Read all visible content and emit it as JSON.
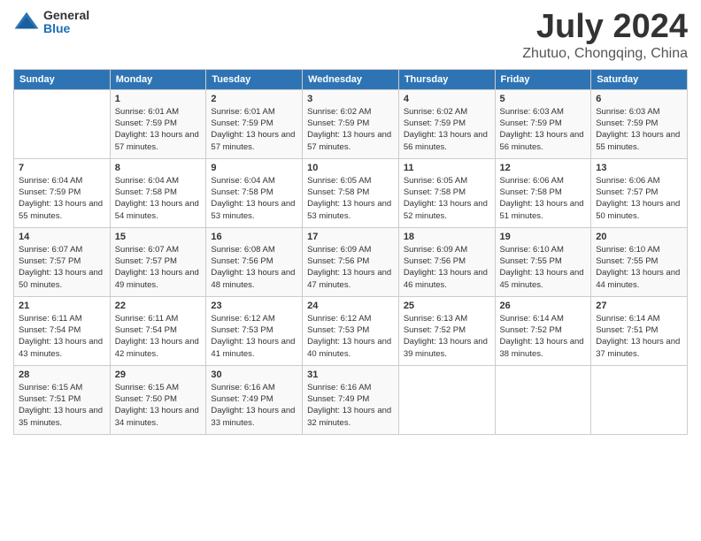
{
  "header": {
    "logo_general": "General",
    "logo_blue": "Blue",
    "title": "July 2024",
    "subtitle": "Zhutuo, Chongqing, China"
  },
  "days_of_week": [
    "Sunday",
    "Monday",
    "Tuesday",
    "Wednesday",
    "Thursday",
    "Friday",
    "Saturday"
  ],
  "weeks": [
    [
      {
        "day": "",
        "sunrise": "",
        "sunset": "",
        "daylight": ""
      },
      {
        "day": "1",
        "sunrise": "Sunrise: 6:01 AM",
        "sunset": "Sunset: 7:59 PM",
        "daylight": "Daylight: 13 hours and 57 minutes."
      },
      {
        "day": "2",
        "sunrise": "Sunrise: 6:01 AM",
        "sunset": "Sunset: 7:59 PM",
        "daylight": "Daylight: 13 hours and 57 minutes."
      },
      {
        "day": "3",
        "sunrise": "Sunrise: 6:02 AM",
        "sunset": "Sunset: 7:59 PM",
        "daylight": "Daylight: 13 hours and 57 minutes."
      },
      {
        "day": "4",
        "sunrise": "Sunrise: 6:02 AM",
        "sunset": "Sunset: 7:59 PM",
        "daylight": "Daylight: 13 hours and 56 minutes."
      },
      {
        "day": "5",
        "sunrise": "Sunrise: 6:03 AM",
        "sunset": "Sunset: 7:59 PM",
        "daylight": "Daylight: 13 hours and 56 minutes."
      },
      {
        "day": "6",
        "sunrise": "Sunrise: 6:03 AM",
        "sunset": "Sunset: 7:59 PM",
        "daylight": "Daylight: 13 hours and 55 minutes."
      }
    ],
    [
      {
        "day": "7",
        "sunrise": "Sunrise: 6:04 AM",
        "sunset": "Sunset: 7:59 PM",
        "daylight": "Daylight: 13 hours and 55 minutes."
      },
      {
        "day": "8",
        "sunrise": "Sunrise: 6:04 AM",
        "sunset": "Sunset: 7:58 PM",
        "daylight": "Daylight: 13 hours and 54 minutes."
      },
      {
        "day": "9",
        "sunrise": "Sunrise: 6:04 AM",
        "sunset": "Sunset: 7:58 PM",
        "daylight": "Daylight: 13 hours and 53 minutes."
      },
      {
        "day": "10",
        "sunrise": "Sunrise: 6:05 AM",
        "sunset": "Sunset: 7:58 PM",
        "daylight": "Daylight: 13 hours and 53 minutes."
      },
      {
        "day": "11",
        "sunrise": "Sunrise: 6:05 AM",
        "sunset": "Sunset: 7:58 PM",
        "daylight": "Daylight: 13 hours and 52 minutes."
      },
      {
        "day": "12",
        "sunrise": "Sunrise: 6:06 AM",
        "sunset": "Sunset: 7:58 PM",
        "daylight": "Daylight: 13 hours and 51 minutes."
      },
      {
        "day": "13",
        "sunrise": "Sunrise: 6:06 AM",
        "sunset": "Sunset: 7:57 PM",
        "daylight": "Daylight: 13 hours and 50 minutes."
      }
    ],
    [
      {
        "day": "14",
        "sunrise": "Sunrise: 6:07 AM",
        "sunset": "Sunset: 7:57 PM",
        "daylight": "Daylight: 13 hours and 50 minutes."
      },
      {
        "day": "15",
        "sunrise": "Sunrise: 6:07 AM",
        "sunset": "Sunset: 7:57 PM",
        "daylight": "Daylight: 13 hours and 49 minutes."
      },
      {
        "day": "16",
        "sunrise": "Sunrise: 6:08 AM",
        "sunset": "Sunset: 7:56 PM",
        "daylight": "Daylight: 13 hours and 48 minutes."
      },
      {
        "day": "17",
        "sunrise": "Sunrise: 6:09 AM",
        "sunset": "Sunset: 7:56 PM",
        "daylight": "Daylight: 13 hours and 47 minutes."
      },
      {
        "day": "18",
        "sunrise": "Sunrise: 6:09 AM",
        "sunset": "Sunset: 7:56 PM",
        "daylight": "Daylight: 13 hours and 46 minutes."
      },
      {
        "day": "19",
        "sunrise": "Sunrise: 6:10 AM",
        "sunset": "Sunset: 7:55 PM",
        "daylight": "Daylight: 13 hours and 45 minutes."
      },
      {
        "day": "20",
        "sunrise": "Sunrise: 6:10 AM",
        "sunset": "Sunset: 7:55 PM",
        "daylight": "Daylight: 13 hours and 44 minutes."
      }
    ],
    [
      {
        "day": "21",
        "sunrise": "Sunrise: 6:11 AM",
        "sunset": "Sunset: 7:54 PM",
        "daylight": "Daylight: 13 hours and 43 minutes."
      },
      {
        "day": "22",
        "sunrise": "Sunrise: 6:11 AM",
        "sunset": "Sunset: 7:54 PM",
        "daylight": "Daylight: 13 hours and 42 minutes."
      },
      {
        "day": "23",
        "sunrise": "Sunrise: 6:12 AM",
        "sunset": "Sunset: 7:53 PM",
        "daylight": "Daylight: 13 hours and 41 minutes."
      },
      {
        "day": "24",
        "sunrise": "Sunrise: 6:12 AM",
        "sunset": "Sunset: 7:53 PM",
        "daylight": "Daylight: 13 hours and 40 minutes."
      },
      {
        "day": "25",
        "sunrise": "Sunrise: 6:13 AM",
        "sunset": "Sunset: 7:52 PM",
        "daylight": "Daylight: 13 hours and 39 minutes."
      },
      {
        "day": "26",
        "sunrise": "Sunrise: 6:14 AM",
        "sunset": "Sunset: 7:52 PM",
        "daylight": "Daylight: 13 hours and 38 minutes."
      },
      {
        "day": "27",
        "sunrise": "Sunrise: 6:14 AM",
        "sunset": "Sunset: 7:51 PM",
        "daylight": "Daylight: 13 hours and 37 minutes."
      }
    ],
    [
      {
        "day": "28",
        "sunrise": "Sunrise: 6:15 AM",
        "sunset": "Sunset: 7:51 PM",
        "daylight": "Daylight: 13 hours and 35 minutes."
      },
      {
        "day": "29",
        "sunrise": "Sunrise: 6:15 AM",
        "sunset": "Sunset: 7:50 PM",
        "daylight": "Daylight: 13 hours and 34 minutes."
      },
      {
        "day": "30",
        "sunrise": "Sunrise: 6:16 AM",
        "sunset": "Sunset: 7:49 PM",
        "daylight": "Daylight: 13 hours and 33 minutes."
      },
      {
        "day": "31",
        "sunrise": "Sunrise: 6:16 AM",
        "sunset": "Sunset: 7:49 PM",
        "daylight": "Daylight: 13 hours and 32 minutes."
      },
      {
        "day": "",
        "sunrise": "",
        "sunset": "",
        "daylight": ""
      },
      {
        "day": "",
        "sunrise": "",
        "sunset": "",
        "daylight": ""
      },
      {
        "day": "",
        "sunrise": "",
        "sunset": "",
        "daylight": ""
      }
    ]
  ]
}
